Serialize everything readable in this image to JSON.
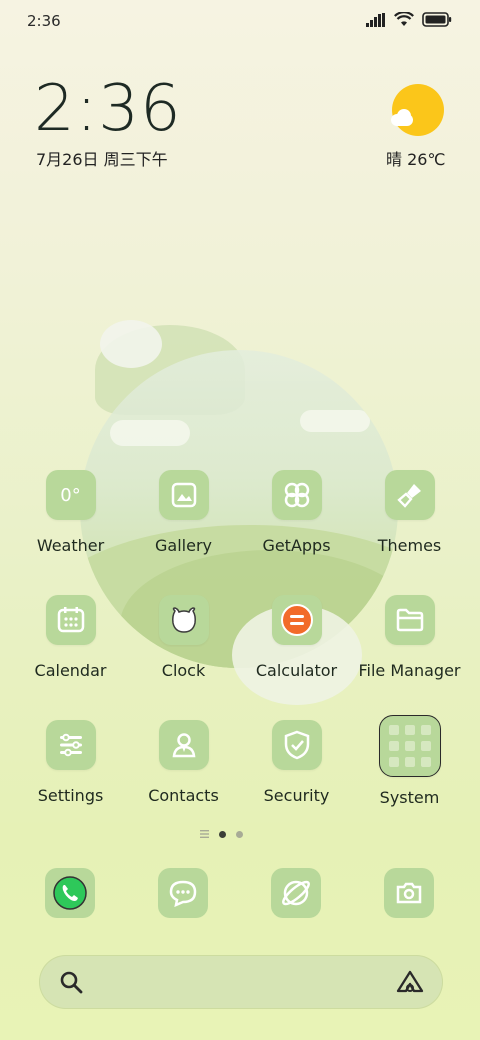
{
  "status": {
    "time": "2:36"
  },
  "clock": {
    "time": "2:36",
    "date": "7月26日 周三下午"
  },
  "weather": {
    "text": "晴 26℃"
  },
  "apps": [
    {
      "label": "Weather",
      "icon": "weather-icon",
      "glyph": "0°"
    },
    {
      "label": "Gallery",
      "icon": "gallery-icon"
    },
    {
      "label": "GetApps",
      "icon": "getapps-icon"
    },
    {
      "label": "Themes",
      "icon": "themes-icon"
    },
    {
      "label": "Calendar",
      "icon": "calendar-icon"
    },
    {
      "label": "Clock",
      "icon": "clock-icon"
    },
    {
      "label": "Calculator",
      "icon": "calculator-icon"
    },
    {
      "label": "File Manager",
      "icon": "file-manager-icon"
    },
    {
      "label": "Settings",
      "icon": "settings-icon"
    },
    {
      "label": "Contacts",
      "icon": "contacts-icon"
    },
    {
      "label": "Security",
      "icon": "security-icon"
    },
    {
      "label": "System",
      "icon": "system-folder-icon"
    }
  ],
  "dock": [
    "phone-icon",
    "messages-icon",
    "browser-icon",
    "camera-icon"
  ],
  "colors": {
    "tile": "#b8d89a",
    "accent_sun": "#fbc61a",
    "calculator": "#f26b2a",
    "phone": "#2ec85a"
  }
}
